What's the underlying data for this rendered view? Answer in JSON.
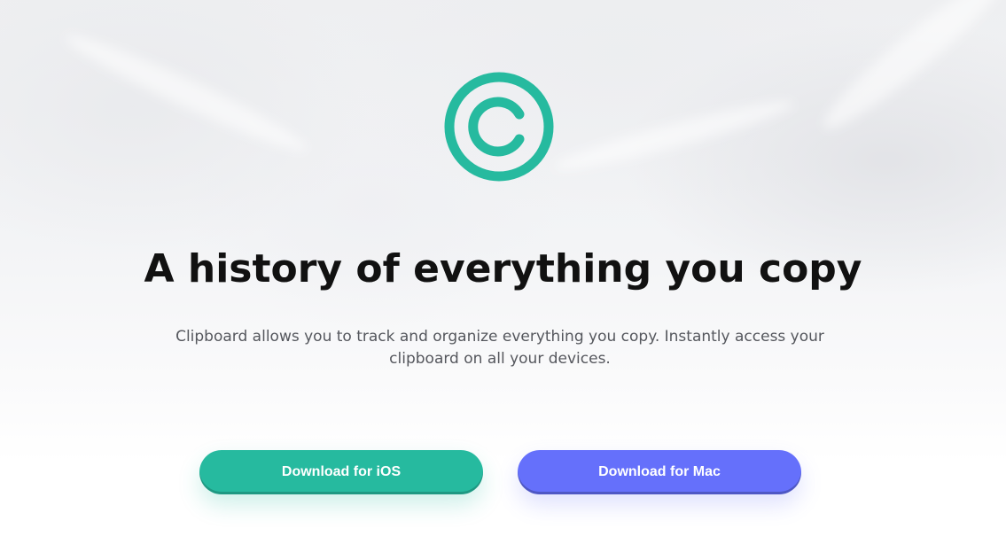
{
  "hero": {
    "logo_icon": "copyright-clipboard-icon",
    "title": "A history of everything you copy",
    "description": "Clipboard allows you to track and organize everything you copy. Instantly access your clipboard on all your devices."
  },
  "buttons": {
    "ios_label": "Download for iOS",
    "mac_label": "Download for Mac"
  },
  "colors": {
    "accent_green": "#26BA9F",
    "accent_blue": "#6570FB",
    "title": "#111111",
    "body_text": "#55575D"
  }
}
